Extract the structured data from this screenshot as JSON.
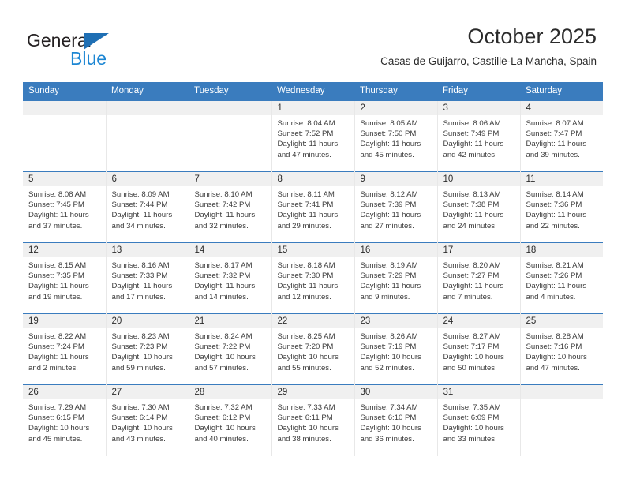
{
  "logo": {
    "word_one": "General",
    "word_two": "Blue",
    "triangle_icon": "triangle-icon",
    "brand_blue": "#1c86d3",
    "triangle_blue": "#1f6fb4"
  },
  "header": {
    "title": "October 2025",
    "location": "Casas de Guijarro, Castille-La Mancha, Spain"
  },
  "calendar": {
    "header_bg": "#3a7cbe",
    "daynum_bg": "#f0f0f0",
    "weekdays": [
      "Sunday",
      "Monday",
      "Tuesday",
      "Wednesday",
      "Thursday",
      "Friday",
      "Saturday"
    ],
    "weeks": [
      [
        {
          "day": "",
          "lines": []
        },
        {
          "day": "",
          "lines": []
        },
        {
          "day": "",
          "lines": []
        },
        {
          "day": "1",
          "lines": [
            "Sunrise: 8:04 AM",
            "Sunset: 7:52 PM",
            "Daylight: 11 hours",
            "and 47 minutes."
          ]
        },
        {
          "day": "2",
          "lines": [
            "Sunrise: 8:05 AM",
            "Sunset: 7:50 PM",
            "Daylight: 11 hours",
            "and 45 minutes."
          ]
        },
        {
          "day": "3",
          "lines": [
            "Sunrise: 8:06 AM",
            "Sunset: 7:49 PM",
            "Daylight: 11 hours",
            "and 42 minutes."
          ]
        },
        {
          "day": "4",
          "lines": [
            "Sunrise: 8:07 AM",
            "Sunset: 7:47 PM",
            "Daylight: 11 hours",
            "and 39 minutes."
          ]
        }
      ],
      [
        {
          "day": "5",
          "lines": [
            "Sunrise: 8:08 AM",
            "Sunset: 7:45 PM",
            "Daylight: 11 hours",
            "and 37 minutes."
          ]
        },
        {
          "day": "6",
          "lines": [
            "Sunrise: 8:09 AM",
            "Sunset: 7:44 PM",
            "Daylight: 11 hours",
            "and 34 minutes."
          ]
        },
        {
          "day": "7",
          "lines": [
            "Sunrise: 8:10 AM",
            "Sunset: 7:42 PM",
            "Daylight: 11 hours",
            "and 32 minutes."
          ]
        },
        {
          "day": "8",
          "lines": [
            "Sunrise: 8:11 AM",
            "Sunset: 7:41 PM",
            "Daylight: 11 hours",
            "and 29 minutes."
          ]
        },
        {
          "day": "9",
          "lines": [
            "Sunrise: 8:12 AM",
            "Sunset: 7:39 PM",
            "Daylight: 11 hours",
            "and 27 minutes."
          ]
        },
        {
          "day": "10",
          "lines": [
            "Sunrise: 8:13 AM",
            "Sunset: 7:38 PM",
            "Daylight: 11 hours",
            "and 24 minutes."
          ]
        },
        {
          "day": "11",
          "lines": [
            "Sunrise: 8:14 AM",
            "Sunset: 7:36 PM",
            "Daylight: 11 hours",
            "and 22 minutes."
          ]
        }
      ],
      [
        {
          "day": "12",
          "lines": [
            "Sunrise: 8:15 AM",
            "Sunset: 7:35 PM",
            "Daylight: 11 hours",
            "and 19 minutes."
          ]
        },
        {
          "day": "13",
          "lines": [
            "Sunrise: 8:16 AM",
            "Sunset: 7:33 PM",
            "Daylight: 11 hours",
            "and 17 minutes."
          ]
        },
        {
          "day": "14",
          "lines": [
            "Sunrise: 8:17 AM",
            "Sunset: 7:32 PM",
            "Daylight: 11 hours",
            "and 14 minutes."
          ]
        },
        {
          "day": "15",
          "lines": [
            "Sunrise: 8:18 AM",
            "Sunset: 7:30 PM",
            "Daylight: 11 hours",
            "and 12 minutes."
          ]
        },
        {
          "day": "16",
          "lines": [
            "Sunrise: 8:19 AM",
            "Sunset: 7:29 PM",
            "Daylight: 11 hours",
            "and 9 minutes."
          ]
        },
        {
          "day": "17",
          "lines": [
            "Sunrise: 8:20 AM",
            "Sunset: 7:27 PM",
            "Daylight: 11 hours",
            "and 7 minutes."
          ]
        },
        {
          "day": "18",
          "lines": [
            "Sunrise: 8:21 AM",
            "Sunset: 7:26 PM",
            "Daylight: 11 hours",
            "and 4 minutes."
          ]
        }
      ],
      [
        {
          "day": "19",
          "lines": [
            "Sunrise: 8:22 AM",
            "Sunset: 7:24 PM",
            "Daylight: 11 hours",
            "and 2 minutes."
          ]
        },
        {
          "day": "20",
          "lines": [
            "Sunrise: 8:23 AM",
            "Sunset: 7:23 PM",
            "Daylight: 10 hours",
            "and 59 minutes."
          ]
        },
        {
          "day": "21",
          "lines": [
            "Sunrise: 8:24 AM",
            "Sunset: 7:22 PM",
            "Daylight: 10 hours",
            "and 57 minutes."
          ]
        },
        {
          "day": "22",
          "lines": [
            "Sunrise: 8:25 AM",
            "Sunset: 7:20 PM",
            "Daylight: 10 hours",
            "and 55 minutes."
          ]
        },
        {
          "day": "23",
          "lines": [
            "Sunrise: 8:26 AM",
            "Sunset: 7:19 PM",
            "Daylight: 10 hours",
            "and 52 minutes."
          ]
        },
        {
          "day": "24",
          "lines": [
            "Sunrise: 8:27 AM",
            "Sunset: 7:17 PM",
            "Daylight: 10 hours",
            "and 50 minutes."
          ]
        },
        {
          "day": "25",
          "lines": [
            "Sunrise: 8:28 AM",
            "Sunset: 7:16 PM",
            "Daylight: 10 hours",
            "and 47 minutes."
          ]
        }
      ],
      [
        {
          "day": "26",
          "lines": [
            "Sunrise: 7:29 AM",
            "Sunset: 6:15 PM",
            "Daylight: 10 hours",
            "and 45 minutes."
          ]
        },
        {
          "day": "27",
          "lines": [
            "Sunrise: 7:30 AM",
            "Sunset: 6:14 PM",
            "Daylight: 10 hours",
            "and 43 minutes."
          ]
        },
        {
          "day": "28",
          "lines": [
            "Sunrise: 7:32 AM",
            "Sunset: 6:12 PM",
            "Daylight: 10 hours",
            "and 40 minutes."
          ]
        },
        {
          "day": "29",
          "lines": [
            "Sunrise: 7:33 AM",
            "Sunset: 6:11 PM",
            "Daylight: 10 hours",
            "and 38 minutes."
          ]
        },
        {
          "day": "30",
          "lines": [
            "Sunrise: 7:34 AM",
            "Sunset: 6:10 PM",
            "Daylight: 10 hours",
            "and 36 minutes."
          ]
        },
        {
          "day": "31",
          "lines": [
            "Sunrise: 7:35 AM",
            "Sunset: 6:09 PM",
            "Daylight: 10 hours",
            "and 33 minutes."
          ]
        },
        {
          "day": "",
          "lines": []
        }
      ]
    ]
  }
}
